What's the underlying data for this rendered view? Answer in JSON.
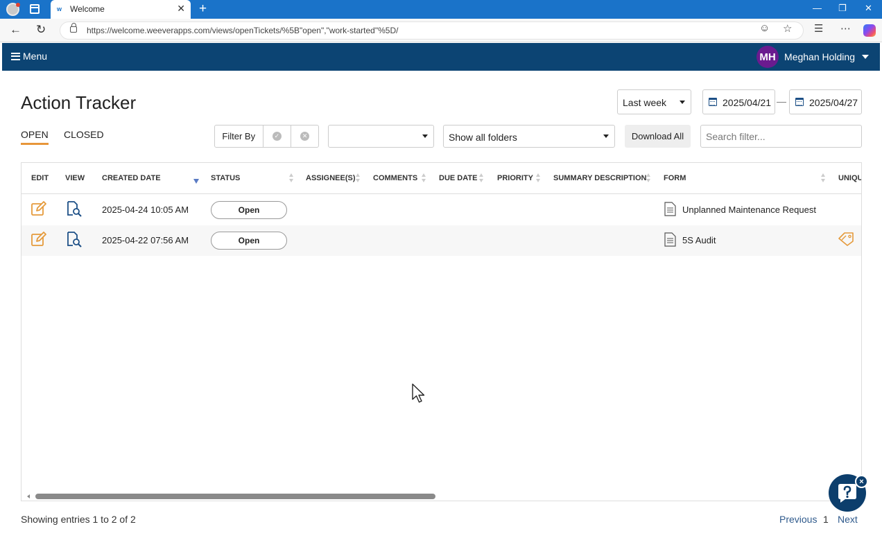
{
  "browser": {
    "tab_title": "Welcome",
    "tab_favicon": "w",
    "url": "https://welcome.weeverapps.com/views/openTickets/%5B\"open\",\"work-started\"%5D/"
  },
  "header": {
    "menu_label": "Menu",
    "avatar_initials": "MH",
    "user_name": "Meghan Holding"
  },
  "page": {
    "title": "Action Tracker",
    "range_selected": "Last week",
    "date_from": "2025/04/21",
    "date_sep": "—",
    "date_to": "2025/04/27"
  },
  "tabs": {
    "open": "OPEN",
    "closed": "CLOSED"
  },
  "toolbar": {
    "filter_by": "Filter By",
    "folders_selected": "Show all folders",
    "download_all": "Download All",
    "search_placeholder": "Search filter..."
  },
  "table": {
    "columns": [
      "EDIT",
      "VIEW",
      "CREATED DATE",
      "STATUS",
      "ASSIGNEE(S)",
      "COMMENTS",
      "DUE DATE",
      "PRIORITY",
      "SUMMARY DESCRIPTION",
      "FORM",
      "UNIQU"
    ],
    "rows": [
      {
        "created": "2025-04-24 10:05 AM",
        "status": "Open",
        "form": "Unplanned Maintenance Request"
      },
      {
        "created": "2025-04-22 07:56 AM",
        "status": "Open",
        "form": "5S Audit"
      }
    ]
  },
  "footer": {
    "entries": "Showing entries 1 to 2 of 2",
    "previous": "Previous",
    "page": "1",
    "next": "Next"
  },
  "help": {
    "close_glyph": "×"
  },
  "colors": {
    "browser_blue": "#1a73c9",
    "header_navy": "#0c4473",
    "accent_orange": "#e7963a",
    "avatar_purple": "#6a1b8f",
    "link_blue": "#2f5a8c"
  },
  "icons": {
    "edit": "edit-icon",
    "view": "view-icon",
    "form": "form-doc-icon",
    "tag": "tag-icon",
    "calendar": "calendar-icon"
  }
}
